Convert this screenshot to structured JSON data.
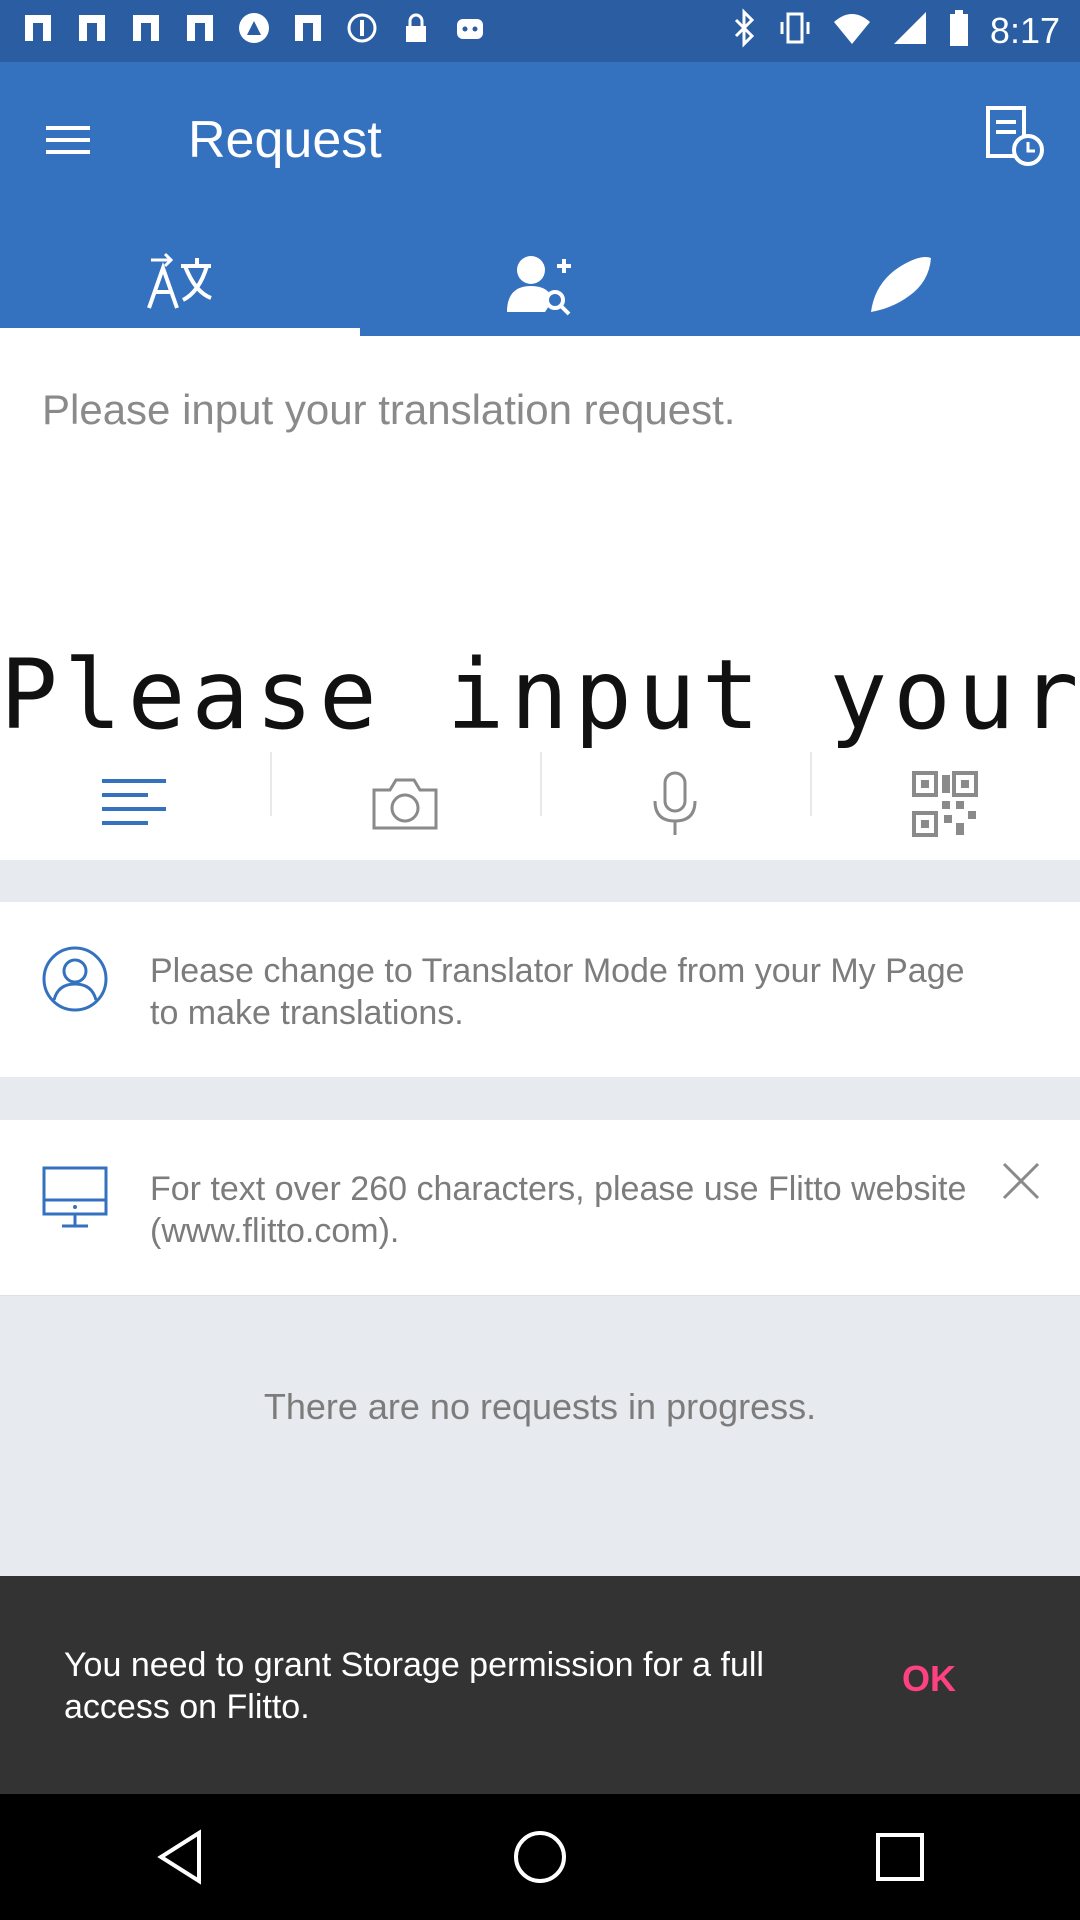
{
  "status_bar": {
    "time": "8:17",
    "left_icons": [
      "app-icon",
      "app-icon",
      "app-icon",
      "app-icon",
      "compass-icon",
      "app-icon",
      "info-circle-icon",
      "lock-icon",
      "robot-icon"
    ],
    "right_icons": [
      "bluetooth-icon",
      "vibrate-icon",
      "wifi-icon",
      "signal-icon",
      "battery-icon"
    ]
  },
  "app_bar": {
    "title": "Request",
    "background": "#3472bf",
    "tabs": [
      {
        "icon": "translate-icon",
        "active": true
      },
      {
        "icon": "add-friend-search-icon",
        "active": false
      },
      {
        "icon": "feather-icon",
        "active": false
      }
    ]
  },
  "request_input": {
    "placeholder": "Please input your translation request.",
    "handwriting_preview": "Please input your trans"
  },
  "input_tools": [
    {
      "icon": "text-lines-icon",
      "active": true
    },
    {
      "icon": "camera-icon",
      "active": false
    },
    {
      "icon": "microphone-icon",
      "active": false
    },
    {
      "icon": "qr-code-icon",
      "active": false
    }
  ],
  "notices": [
    {
      "icon": "user-circle-icon",
      "text": "Please change to Translator Mode from your My Page to make translations."
    },
    {
      "icon": "monitor-icon",
      "text": "For text over 260 characters, please use Flitto website (www.flitto.com)."
    }
  ],
  "empty_state": {
    "text": "There are no requests in progress."
  },
  "snackbar": {
    "message": "You need to grant Storage permission for a full access on Flitto.",
    "action": "OK",
    "action_color": "#ff4081"
  },
  "nav_bar": {
    "buttons": [
      "back-icon",
      "home-icon",
      "recents-icon"
    ]
  }
}
